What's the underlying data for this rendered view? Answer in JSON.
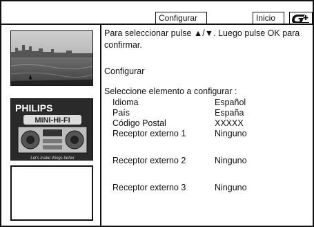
{
  "header": {
    "tab_active": "Configurar",
    "tab_home": "Inicio",
    "logo_name": "gplus-logo"
  },
  "instructions": "Para seleccionar pulse ▲/▼. Luego pulse OK para confirmar.",
  "section_title": "Configurar",
  "select_label": "Seleccione elemento a configurar :",
  "items": [
    {
      "label": "Idioma",
      "value": "Español"
    },
    {
      "label": "País",
      "value": "España"
    },
    {
      "label": "Código Postal",
      "value": "XXXXX"
    },
    {
      "label": "Receptor externo 1",
      "value": "Ninguno"
    },
    {
      "label": "Receptor externo 2",
      "value": "Ninguno"
    },
    {
      "label": "Receptor externo 3",
      "value": "Ninguno"
    }
  ],
  "thumbnails": {
    "brand": "PHILIPS",
    "product": "MINI-HI-FI",
    "tagline": "Let's make things better"
  },
  "colors": {
    "border": "#111111",
    "background": "#ffffff"
  }
}
